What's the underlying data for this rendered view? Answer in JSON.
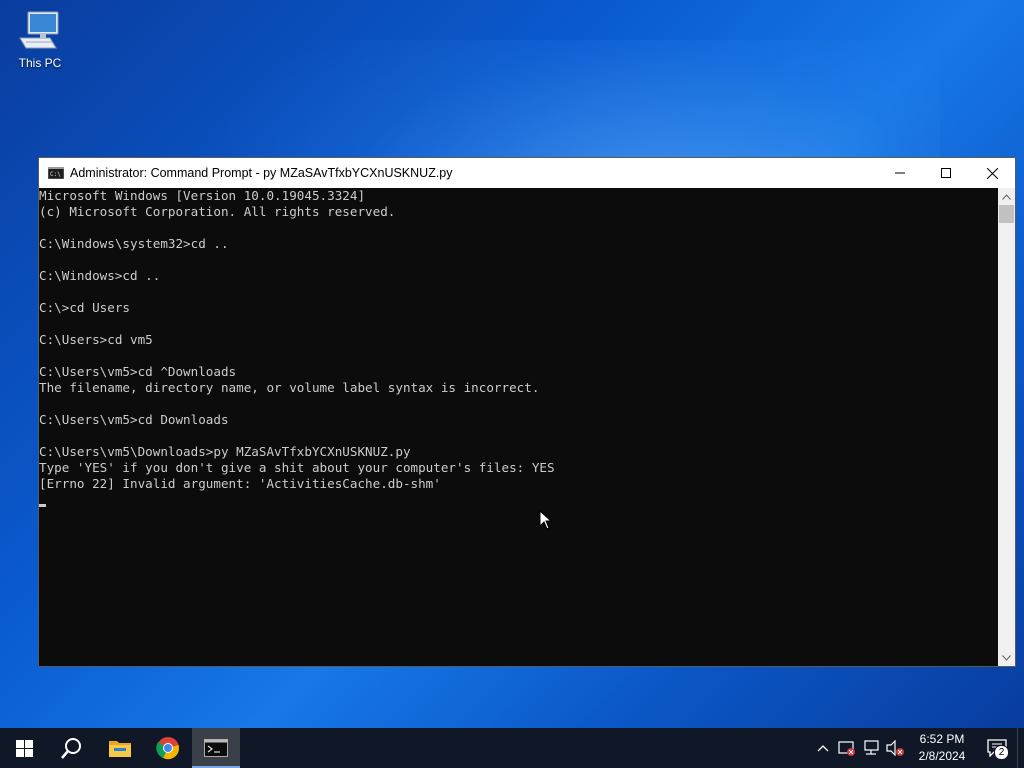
{
  "desktop": {
    "icons": [
      {
        "label": "This PC",
        "icon": "this-pc-icon"
      }
    ]
  },
  "window": {
    "title": "Administrator: Command Prompt - py  MZaSAvTfxbYCXnUSKNUZ.py",
    "console_lines": [
      "Microsoft Windows [Version 10.0.19045.3324]",
      "(c) Microsoft Corporation. All rights reserved.",
      "",
      "C:\\Windows\\system32>cd ..",
      "",
      "C:\\Windows>cd ..",
      "",
      "C:\\>cd Users",
      "",
      "C:\\Users>cd vm5",
      "",
      "C:\\Users\\vm5>cd ^Downloads",
      "The filename, directory name, or volume label syntax is incorrect.",
      "",
      "C:\\Users\\vm5>cd Downloads",
      "",
      "C:\\Users\\vm5\\Downloads>py MZaSAvTfxbYCXnUSKNUZ.py",
      "Type 'YES' if you don't give a shit about your computer's files: YES",
      "[Errno 22] Invalid argument: 'ActivitiesCache.db-shm'"
    ]
  },
  "taskbar": {
    "apps": [
      "start-icon",
      "search-icon",
      "file-explorer-icon",
      "chrome-icon",
      "command-prompt-icon"
    ],
    "clock": {
      "time": "6:52 PM",
      "date": "2/8/2024"
    },
    "notification_count": "2"
  },
  "colors": {
    "console_bg": "#0c0c0c",
    "console_text": "#cccccc",
    "taskbar_bg": "#101827"
  }
}
